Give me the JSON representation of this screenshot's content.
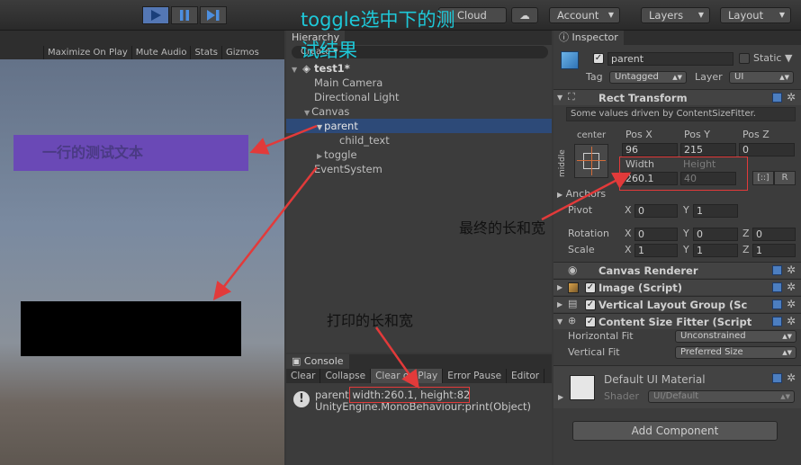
{
  "toolbar": {
    "play_icon": "play-icon",
    "pause_icon": "pause-icon",
    "step_icon": "step-icon",
    "cloud_label": "Cloud",
    "account_label": "Account",
    "layers_label": "Layers",
    "layout_label": "Layout"
  },
  "game": {
    "tools": [
      "Maximize On Play",
      "Mute Audio",
      "Stats",
      "Gizmos"
    ],
    "text_element": "一行的测试文本"
  },
  "hierarchy": {
    "tab_label": "Hierarchy",
    "create_label": "Create",
    "scene": "test1*",
    "items": [
      "Main Camera",
      "Directional Light",
      "Canvas",
      "parent",
      "child_text",
      "toggle",
      "EventSystem"
    ]
  },
  "console": {
    "tab_label": "Console",
    "tools": [
      "Clear",
      "Collapse",
      "Clear on Play",
      "Error Pause",
      "Editor"
    ],
    "message_prefix": "parent ",
    "message_value": "width:260.1, height:82",
    "message_line2": "UnityEngine.MonoBehaviour:print(Object)"
  },
  "inspector": {
    "tab_label": "Inspector",
    "object_name": "parent",
    "static_label": "Static",
    "tag_label": "Tag",
    "tag_value": "Untagged",
    "layer_label": "Layer",
    "layer_value": "UI",
    "rect_transform": {
      "title": "Rect Transform",
      "note": "Some values driven by ContentSizeFitter.",
      "anchor_h": "center",
      "anchor_v": "middle",
      "posx_label": "Pos X",
      "posy_label": "Pos Y",
      "posz_label": "Pos Z",
      "posx": "96",
      "posy": "215",
      "posz": "0",
      "width_label": "Width",
      "height_label": "Height",
      "width": "260.1",
      "height": "40",
      "r_label": "R",
      "anchors_label": "Anchors",
      "pivot_label": "Pivot",
      "pivot_x": "0",
      "pivot_y": "1",
      "rotation_label": "Rotation",
      "rot_x": "0",
      "rot_y": "0",
      "rot_z": "0",
      "scale_label": "Scale",
      "scale_x": "1",
      "scale_y": "1",
      "scale_z": "1",
      "x": "X",
      "y": "Y",
      "z": "Z"
    },
    "canvas_renderer": "Canvas Renderer",
    "image_script": "Image (Script)",
    "vlg_script": "Vertical Layout Group (Sc",
    "csf_script": "Content Size Fitter (Script",
    "horizontal_fit_label": "Horizontal Fit",
    "horizontal_fit": "Unconstrained",
    "vertical_fit_label": "Vertical Fit",
    "vertical_fit": "Preferred Size",
    "material_name": "Default UI Material",
    "shader_label": "Shader",
    "shader_value": "UI/Default",
    "add_component": "Add Component"
  },
  "annotations": {
    "top": "toggle选中下的测",
    "top2": "试结果",
    "final_size": "最终的长和宽",
    "printed_size": "打印的长和宽"
  },
  "colors": {
    "selection": "#2d4a78",
    "annotation_red": "#e23a3a",
    "annotation_cyan": "#1ec8d8",
    "image_purple": "#6a49b6"
  }
}
